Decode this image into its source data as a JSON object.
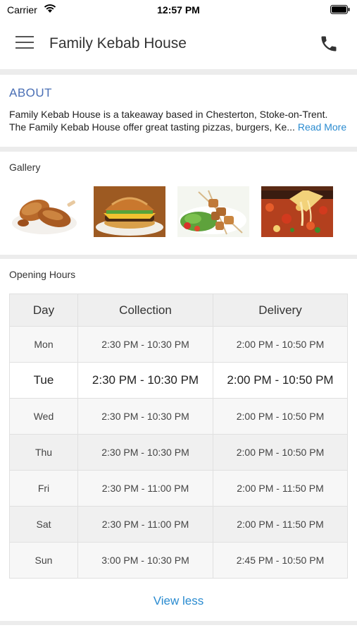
{
  "status_bar": {
    "carrier": "Carrier",
    "time": "12:57 PM"
  },
  "header": {
    "title": "Family Kebab House",
    "menu_icon": "hamburger-menu-icon",
    "call_icon": "phone-icon"
  },
  "about": {
    "title": "ABOUT",
    "line1": "Family Kebab House is a takeaway based in Chesterton, Stoke-on-Trent.",
    "line2": "The Family Kebab House offer great tasting pizzas, burgers, Ke...",
    "read_more": "Read More"
  },
  "gallery": {
    "label": "Gallery",
    "images": [
      "fried-chicken",
      "burger",
      "kebab-skewers",
      "pizza"
    ]
  },
  "opening_hours": {
    "label": "Opening Hours",
    "columns": [
      "Day",
      "Collection",
      "Delivery"
    ],
    "rows": [
      {
        "day": "Mon",
        "collection": "2:30 PM - 10:30 PM",
        "delivery": "2:00 PM - 10:50 PM"
      },
      {
        "day": "Tue",
        "collection": "2:30 PM - 10:30 PM",
        "delivery": "2:00 PM - 10:50 PM"
      },
      {
        "day": "Wed",
        "collection": "2:30 PM - 10:30 PM",
        "delivery": "2:00 PM - 10:50 PM"
      },
      {
        "day": "Thu",
        "collection": "2:30 PM - 10:30 PM",
        "delivery": "2:00 PM - 10:50 PM"
      },
      {
        "day": "Fri",
        "collection": "2:30 PM - 11:00 PM",
        "delivery": "2:00 PM - 11:50 PM"
      },
      {
        "day": "Sat",
        "collection": "2:30 PM - 11:00 PM",
        "delivery": "2:00 PM - 11:50 PM"
      },
      {
        "day": "Sun",
        "collection": "3:00 PM - 10:30 PM",
        "delivery": "2:45 PM - 10:50 PM"
      }
    ],
    "today": "Tue",
    "toggle_label": "View less"
  },
  "colors": {
    "accent_blue": "#2a8bd0",
    "about_title": "#4a6fb5"
  }
}
